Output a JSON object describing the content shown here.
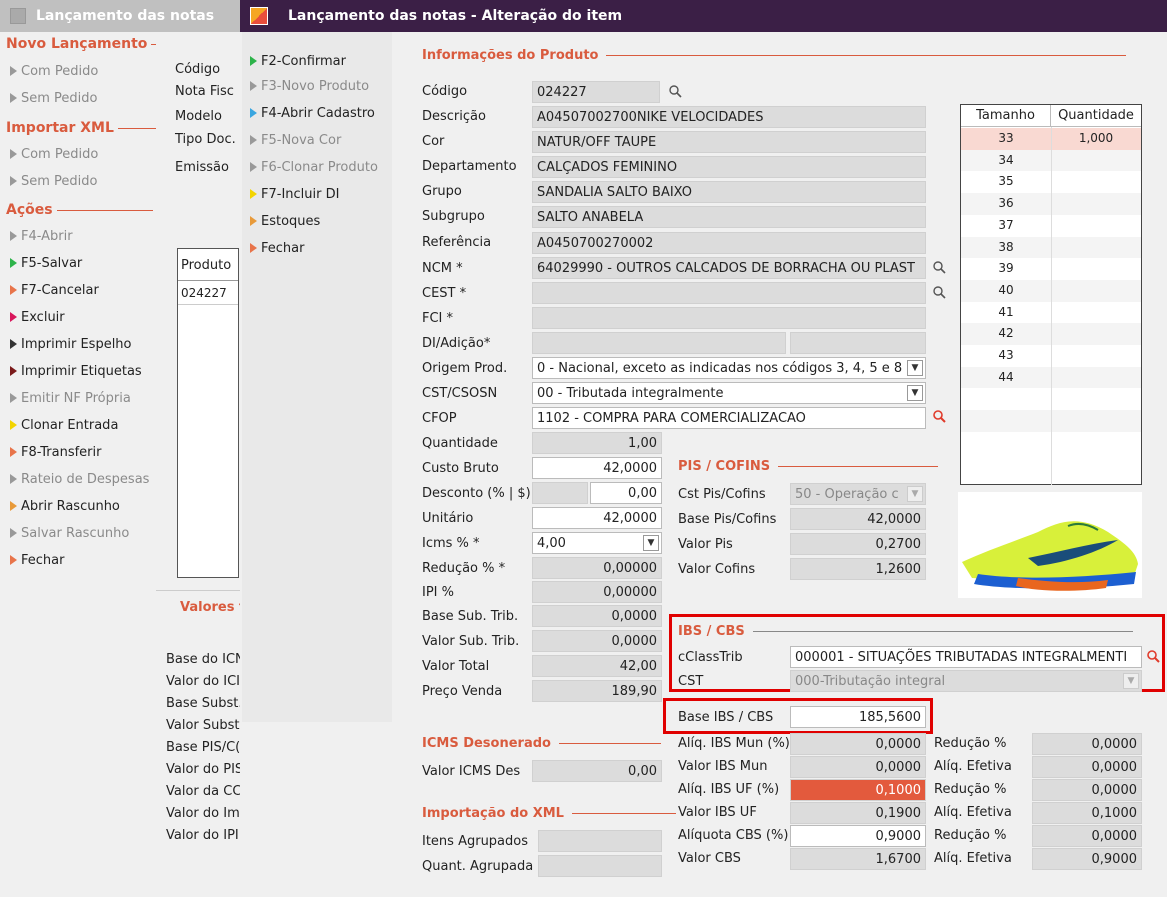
{
  "bg_window": {
    "title": "Lançamento das notas",
    "nav_sections": {
      "novo": "Novo Lançamento",
      "importar": "Importar XML",
      "acoes": "Ações"
    },
    "novo_items": [
      "Com Pedido",
      "Sem Pedido"
    ],
    "importar_items": [
      "Com Pedido",
      "Sem Pedido"
    ],
    "acoes_items": [
      "F4-Abrir",
      "F5-Salvar",
      "F7-Cancelar",
      "Excluir",
      "Imprimir Espelho",
      "Imprimir Etiquetas",
      "Emitir NF Própria",
      "Clonar Entrada",
      "F8-Transferir",
      "Rateio de Despesas",
      "Abrir Rascunho",
      "Salvar Rascunho",
      "Fechar"
    ],
    "form_labels": [
      "Código",
      "Nota Fisc",
      "Modelo",
      "Tipo Doc.",
      "Emissão"
    ],
    "grid_header": "Produto",
    "grid_value": "024227",
    "valores_title": "Valores t",
    "valores_labels": [
      "Base do ICN",
      "Valor do ICI",
      "Base Subst.",
      "Valor Subst",
      "Base PIS/C(",
      "Valor do PIS",
      "Valor da CC",
      "Valor do Im",
      "Valor do IPI"
    ]
  },
  "dialog": {
    "title": "Lançamento das notas - Alteração do item",
    "fmenu": [
      "F2-Confirmar",
      "F3-Novo Produto",
      "F4-Abrir Cadastro",
      "F5-Nova Cor",
      "F6-Clonar Produto",
      "F7-Incluir DI",
      "Estoques",
      "Fechar"
    ],
    "info_title": "Informações do Produto",
    "fields": {
      "codigo": {
        "label": "Código",
        "value": "024227"
      },
      "descricao": {
        "label": "Descrição",
        "value": "A04507002700NIKE VELOCIDADES"
      },
      "cor": {
        "label": "Cor",
        "value": "NATUR/OFF TAUPE"
      },
      "departamento": {
        "label": "Departamento",
        "value": "CALÇADOS FEMININO"
      },
      "grupo": {
        "label": "Grupo",
        "value": "SANDALIA SALTO BAIXO"
      },
      "subgrupo": {
        "label": "Subgrupo",
        "value": "SALTO ANABELA"
      },
      "referencia": {
        "label": "Referência",
        "value": "A0450700270002"
      },
      "ncm": {
        "label": "NCM *",
        "value": "64029990 - OUTROS CALCADOS DE BORRACHA OU PLAST"
      },
      "cest": {
        "label": "CEST *",
        "value": ""
      },
      "fci": {
        "label": "FCI *",
        "value": ""
      },
      "di": {
        "label": "DI/Adição*",
        "value": ""
      },
      "origem": {
        "label": "Origem Prod.",
        "value": "0 - Nacional, exceto as indicadas nos códigos 3, 4, 5 e 8"
      },
      "cst_csosn": {
        "label": "CST/CSOSN",
        "value": "00 - Tributada integralmente"
      },
      "cfop": {
        "label": "CFOP",
        "value": "1102 - COMPRA PARA COMERCIALIZACAO"
      },
      "quantidade": {
        "label": "Quantidade",
        "value": "1,00"
      },
      "custo_bruto": {
        "label": "Custo Bruto",
        "value": "42,0000"
      },
      "desconto": {
        "label": "Desconto (% | $)",
        "value": "0,00"
      },
      "unitario": {
        "label": "Unitário",
        "value": "42,0000"
      },
      "icms": {
        "label": "Icms  % *",
        "value": "4,00"
      },
      "reducao": {
        "label": "Redução % *",
        "value": "0,00000"
      },
      "ipi": {
        "label": "IPI %",
        "value": "0,00000"
      },
      "base_sub": {
        "label": "Base Sub. Trib.",
        "value": "0,0000"
      },
      "valor_sub": {
        "label": "Valor Sub. Trib.",
        "value": "0,0000"
      },
      "valor_total": {
        "label": "Valor Total",
        "value": "42,00"
      },
      "preco_venda": {
        "label": "Preço Venda",
        "value": "189,90"
      }
    },
    "sizes": {
      "headers": [
        "Tamanho",
        "Quantidade"
      ],
      "rows": [
        {
          "t": "33",
          "q": "1,000"
        },
        {
          "t": "34",
          "q": ""
        },
        {
          "t": "35",
          "q": ""
        },
        {
          "t": "36",
          "q": ""
        },
        {
          "t": "37",
          "q": ""
        },
        {
          "t": "38",
          "q": ""
        },
        {
          "t": "39",
          "q": ""
        },
        {
          "t": "40",
          "q": ""
        },
        {
          "t": "41",
          "q": ""
        },
        {
          "t": "42",
          "q": ""
        },
        {
          "t": "43",
          "q": ""
        },
        {
          "t": "44",
          "q": ""
        },
        {
          "t": "",
          "q": ""
        },
        {
          "t": "",
          "q": ""
        },
        {
          "t": "",
          "q": ""
        }
      ]
    },
    "pis": {
      "title": "PIS / COFINS",
      "cst_label": "Cst Pis/Cofins",
      "cst_value": "50 - Operação c",
      "base_label": "Base Pis/Cofins",
      "base_value": "42,0000",
      "valor_pis_label": "Valor Pis",
      "valor_pis_value": "0,2700",
      "valor_cofins_label": "Valor Cofins",
      "valor_cofins_value": "1,2600"
    },
    "ibs": {
      "title": "IBS / CBS",
      "cclass_label": "cClassTrib",
      "cclass_value": "000001 - SITUAÇÕES TRIBUTADAS INTEGRALMENTI",
      "cst_label": "CST",
      "cst_value": "000-Tributação integral",
      "base_label": "Base IBS / CBS",
      "base_value": "185,5600",
      "rows": [
        {
          "l1": "Alíq. IBS Mun (%)",
          "v1": "0,0000",
          "l2": "Redução %",
          "v2": "0,0000"
        },
        {
          "l1": "Valor IBS Mun",
          "v1": "0,0000",
          "l2": "Alíq. Efetiva",
          "v2": "0,0000"
        },
        {
          "l1": "Alíq. IBS UF (%)",
          "v1": "0,1000",
          "l2": "Redução %",
          "v2": "0,0000"
        },
        {
          "l1": "Valor IBS UF",
          "v1": "0,1900",
          "l2": "Alíq. Efetiva",
          "v2": "0,1000"
        },
        {
          "l1": "Alíquota CBS (%)",
          "v1": "0,9000",
          "l2": "Redução %",
          "v2": "0,0000"
        },
        {
          "l1": "Valor CBS",
          "v1": "1,6700",
          "l2": "Alíq. Efetiva",
          "v2": "0,9000"
        }
      ]
    },
    "icms_des": {
      "title": "ICMS Desonerado",
      "label": "Valor ICMS Des",
      "value": "0,00"
    },
    "import_xml": {
      "title": "Importação do XML",
      "itens_label": "Itens Agrupados",
      "quant_label": "Quant. Agrupada"
    },
    "colors": {
      "accent": "#d95b3e",
      "titlebar": "#3b1f46",
      "highlight_row": "#f9d9d2",
      "red_frame": "#e00000",
      "ibs_uf_field": "#e35a3d"
    }
  }
}
